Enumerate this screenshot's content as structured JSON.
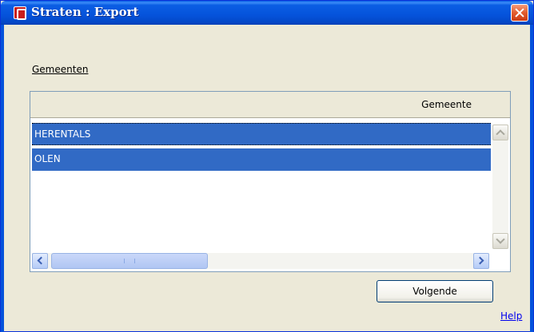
{
  "window": {
    "title": "Straten : Export",
    "app_icon": "app-icon",
    "close_icon": "close-icon"
  },
  "section": {
    "label": "Gemeenten"
  },
  "grid": {
    "columns": [
      "Gemeente"
    ],
    "rows": [
      {
        "value": "HERENTALS",
        "selected": true
      },
      {
        "value": "OLEN",
        "selected": true
      }
    ],
    "selection_color": "#316ac5"
  },
  "buttons": {
    "next_label": "Volgende"
  },
  "links": {
    "help_label": "Help"
  }
}
